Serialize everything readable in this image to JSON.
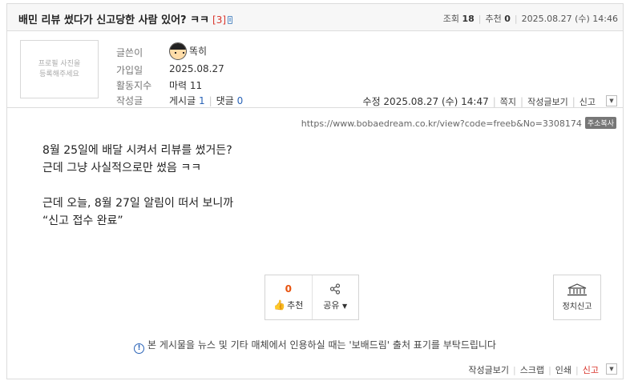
{
  "post": {
    "title": "배민 리뷰 썼다가 신고당한 사람 있어? ㅋㅋ",
    "comment_count": "[3]",
    "views_label": "조회",
    "views": "18",
    "recommend_label": "추천",
    "recommend": "0",
    "date": "2025.08.27 (수) 14:46"
  },
  "profile": {
    "photo_placeholder_line1": "프로필 사진을",
    "photo_placeholder_line2": "등록해주세요",
    "writer_label": "글쓴이",
    "writer": "똑히",
    "joined_label": "가입일",
    "joined": "2025.08.27",
    "activity_label": "활동지수",
    "activity": "마력 11",
    "posts_label": "작성글",
    "posts_text": "게시글",
    "posts_count": "1",
    "comments_text": "댓글",
    "comments_count": "0",
    "modified": "수정 2025.08.27 (수) 14:47",
    "message_link": "쪽지",
    "view_posts_link": "작성글보기",
    "report_link": "신고"
  },
  "url": {
    "text": "https://www.bobaedream.co.kr/view?code=freeb&No=3308174",
    "copy_label": "주소복사"
  },
  "content": {
    "line1": "8월 25일에 배달 시켜서 리뷰를 썼거든?",
    "line2": "근데 그냥 사실적으로만 썼음 ㅋㅋ",
    "line3": "근데 오늘, 8월 27일 알림이 떠서 보니까",
    "line4": "“신고 접수 완료”"
  },
  "actions": {
    "recommend_count": "0",
    "recommend_label": "추천",
    "share_label": "공유",
    "political_report_label": "정치신고"
  },
  "notice": "본 게시물을 뉴스 및 기타 매체에서 인용하실 때는 '보배드림' 출처 표기를 부탁드립니다",
  "footer": {
    "view_posts": "작성글보기",
    "scrap": "스크랩",
    "print": "인쇄",
    "report": "신고"
  },
  "colors": {
    "accent_red": "#d9342b",
    "link_blue": "#2a63b7",
    "recommend_orange": "#e8530e"
  }
}
